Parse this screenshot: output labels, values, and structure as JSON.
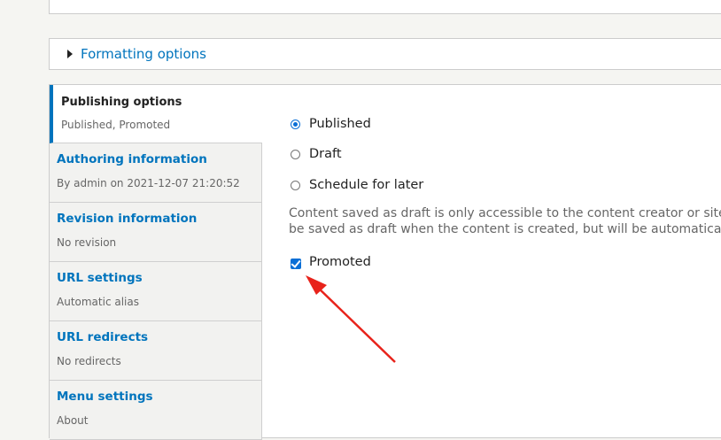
{
  "formatting": {
    "summary": "Formatting options"
  },
  "vertical_tabs": [
    {
      "title": "Publishing options",
      "summary": "Published, Promoted",
      "active": true
    },
    {
      "title": "Authoring information",
      "summary": "By admin on 2021-12-07 21:20:52"
    },
    {
      "title": "Revision information",
      "summary": "No revision"
    },
    {
      "title": "URL settings",
      "summary": "Automatic alias"
    },
    {
      "title": "URL redirects",
      "summary": "No redirects"
    },
    {
      "title": "Menu settings",
      "summary": "About"
    }
  ],
  "publishing": {
    "options": [
      {
        "label": "Published",
        "checked": true
      },
      {
        "label": "Draft",
        "checked": false
      },
      {
        "label": "Schedule for later",
        "checked": false
      }
    ],
    "description_line1": "Content saved as draft is only accessible to the content creator or site a",
    "description_line2": "be saved as draft when the content is created, but will be automatically",
    "promoted_label": "Promoted",
    "promoted_checked": true
  },
  "colors": {
    "link": "#0074bd",
    "accent": "#0a6fd6",
    "annotation": "#e8231b"
  }
}
